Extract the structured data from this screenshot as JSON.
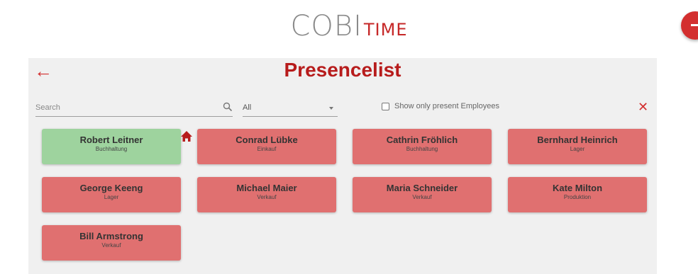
{
  "logo": {
    "main": "COBI",
    "sub": "TIME"
  },
  "header": {
    "back_label": "←",
    "title": "Presencelist"
  },
  "toolbar": {
    "search_placeholder": "Search",
    "filter_value": "All",
    "present_only_label": "Show only present Employees",
    "close_label": "✕"
  },
  "colors": {
    "present": "#9ed39e",
    "absent": "#e07070",
    "accent": "#d32f2f",
    "title": "#b71c1c"
  },
  "employees": [
    {
      "name": "Robert Leitner",
      "department": "Buchhaltung",
      "present": true
    },
    {
      "name": "Conrad Lübke",
      "department": "Einkauf",
      "present": false
    },
    {
      "name": "Cathrin Fröhlich",
      "department": "Buchhaltung",
      "present": false
    },
    {
      "name": "Bernhard Heinrich",
      "department": "Lager",
      "present": false
    },
    {
      "name": "George Keeng",
      "department": "Lager",
      "present": false
    },
    {
      "name": "Michael Maier",
      "department": "Verkauf",
      "present": false
    },
    {
      "name": "Maria Schneider",
      "department": "Verkauf",
      "present": false
    },
    {
      "name": "Kate Milton",
      "department": "Produktion",
      "present": false
    },
    {
      "name": "Bill Armstrong",
      "department": "Verkauf",
      "present": false
    }
  ]
}
